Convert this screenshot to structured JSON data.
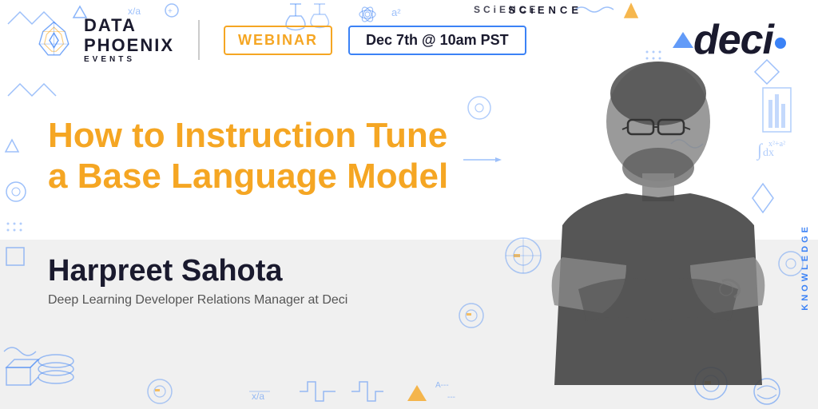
{
  "logo": {
    "data_text": "DATA",
    "phoenix_text": "PHOENIX",
    "events_text": "EVENTS"
  },
  "header": {
    "webinar_label": "WEBINAR",
    "date_label": "Dec 7th @ 10am PST"
  },
  "deci": {
    "text": "deci",
    "dot": "."
  },
  "title": {
    "line1": "How to Instruction Tune",
    "line2": "a Base Language Model"
  },
  "speaker": {
    "name": "Harpreet Sahota",
    "role": "Deep Learning Developer Relations Manager at Deci"
  },
  "decorations": {
    "science_label": "SCiENCE",
    "knowledge_label": "KNOWLEDGE"
  },
  "colors": {
    "orange": "#f5a623",
    "blue": "#3b82f6",
    "dark": "#1a1a2e",
    "light_gray": "#f0f0f0",
    "white": "#ffffff"
  }
}
